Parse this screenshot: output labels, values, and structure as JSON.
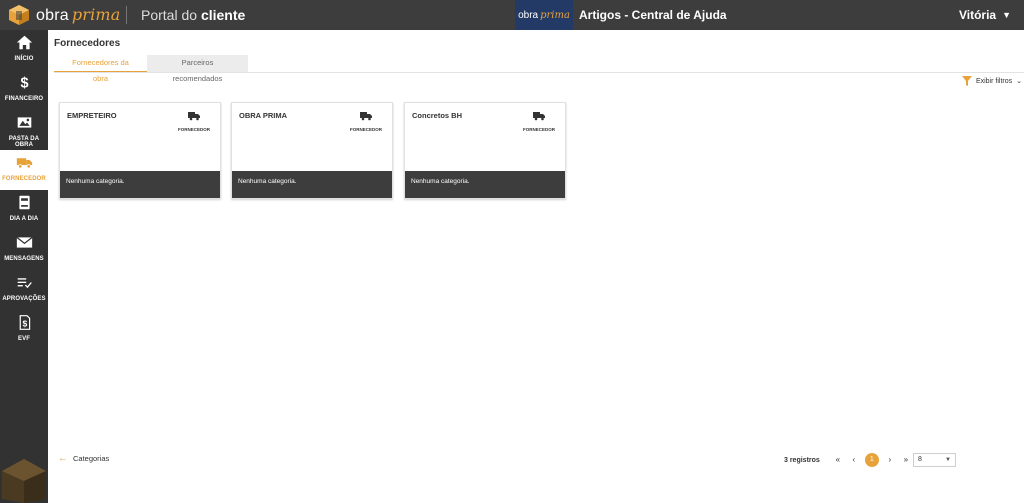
{
  "header": {
    "brand_primary": "obra",
    "brand_secondary": "prima",
    "portal_prefix": "Portal do",
    "portal_suffix": "cliente",
    "help_logo_primary": "obra",
    "help_logo_secondary": "prima",
    "help_title": "Artigos - Central de Ajuda",
    "user_name": "Vitória"
  },
  "sidebar": {
    "items": [
      {
        "label": "INÍCIO",
        "icon": "home-icon"
      },
      {
        "label": "FINANCEIRO",
        "icon": "dollar-icon"
      },
      {
        "label": "PASTA DA OBRA",
        "icon": "image-icon"
      },
      {
        "label": "FORNECEDOR",
        "icon": "truck-icon",
        "active": true
      },
      {
        "label": "DIA A DIA",
        "icon": "book-icon"
      },
      {
        "label": "MENSAGENS",
        "icon": "envelope-icon"
      },
      {
        "label": "APROVAÇÕES",
        "icon": "list-check-icon"
      },
      {
        "label": "EVF",
        "icon": "dollar-document-icon"
      }
    ]
  },
  "main": {
    "title": "Fornecedores",
    "tabs": [
      {
        "label": "Fornecedores da obra",
        "active": true
      },
      {
        "label": "Parceiros recomendados",
        "active": false
      }
    ],
    "filters_label": "Exibir filtros",
    "cards": [
      {
        "name": "EMPRETEIRO",
        "badge": "FORNECEDOR",
        "category": "Nenhuma categoria."
      },
      {
        "name": "OBRA PRIMA",
        "badge": "FORNECEDOR",
        "category": "Nenhuma categoria."
      },
      {
        "name": "Concretos BH",
        "badge": "FORNECEDOR",
        "category": "Nenhuma categoria."
      }
    ],
    "back_label": "Categorias",
    "pagination": {
      "records": "3 registros",
      "first": "«",
      "prev": "‹",
      "current": "1",
      "next": "›",
      "last": "»",
      "page_size": "8"
    }
  },
  "colors": {
    "accent": "#e8a23a",
    "topbar": "#3d3d3d",
    "sidebar": "#323232",
    "card_footer": "#3d3d3d"
  }
}
